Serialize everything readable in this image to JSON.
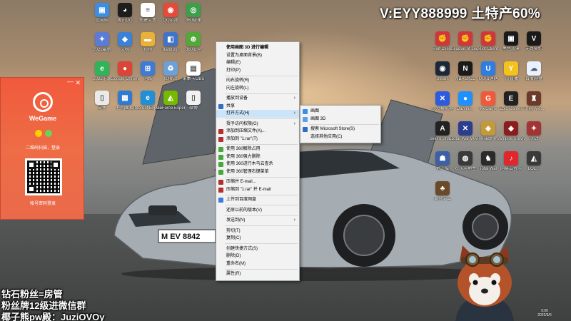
{
  "overlay": {
    "watermark": "V:EYY888999 土特产60%",
    "line1": "钻石粉丝=房管",
    "line2": "粉丝牌12级进微信群",
    "line3": "椰子熊pw殿：JuziOVOy"
  },
  "desktop_icons_left": [
    {
      "name": "this-pc",
      "label": "此电脑",
      "color": "#3a8ee6",
      "glyph": "▣"
    },
    {
      "name": "qq",
      "label": "腾讯QQ",
      "color": "#1d1d1d",
      "glyph": "◕"
    },
    {
      "name": "new-text",
      "label": "新建文本",
      "color": "#ffffff",
      "glyph": "≡"
    },
    {
      "name": "qq-game",
      "label": "QQ游戏",
      "color": "#e84a3a",
      "glyph": "◉"
    },
    {
      "name": "360-speed",
      "label": "360极速",
      "color": "#3ca04b",
      "glyph": "◎"
    },
    {
      "name": "2022-lol",
      "label": "2022最新",
      "color": "#5a7bd6",
      "glyph": "✦"
    },
    {
      "name": "doc",
      "label": "文档",
      "color": "#3b82d6",
      "glyph": "◆"
    },
    {
      "name": "folder1",
      "label": "视频",
      "color": "#e8b23a",
      "glyph": "▬"
    },
    {
      "name": "bandizip",
      "label": "Bandizip",
      "color": "#4074c9",
      "glyph": "◧"
    },
    {
      "name": "360-safe",
      "label": "360安全",
      "color": "#53a83a",
      "glyph": "⊕"
    },
    {
      "name": "iqiyi",
      "label": "2022乐享",
      "color": "#2fb45a",
      "glyph": "e"
    },
    {
      "name": "chrome",
      "label": "Google Chrome",
      "color": "#db4437",
      "glyph": "●"
    },
    {
      "name": "network",
      "label": "网络",
      "color": "#3f7bd4",
      "glyph": "⊞"
    },
    {
      "name": "recycle",
      "label": "回收站",
      "color": "#6da0d8",
      "glyph": "♻"
    },
    {
      "name": "obs",
      "label": "采集卡OBS",
      "color": "#ffffff",
      "glyph": "▤"
    },
    {
      "name": "file2",
      "label": "文件",
      "color": "#eaeaea",
      "glyph": "▯"
    },
    {
      "name": "control",
      "label": "控制面板",
      "color": "#2e7bd1",
      "glyph": "▦"
    },
    {
      "name": "ie",
      "label": "Internet Explorer",
      "color": "#1f8fd8",
      "glyph": "e"
    },
    {
      "name": "geforce",
      "label": "GeForce Experie...",
      "color": "#76b900",
      "glyph": "◭"
    },
    {
      "name": "wps",
      "label": "微博",
      "color": "#f2f2f2",
      "glyph": "▯"
    }
  ],
  "desktop_icons_right": [
    {
      "name": "riot-client",
      "label": "Riot Client",
      "color": "#d13639",
      "glyph": "✊"
    },
    {
      "name": "lol",
      "label": "League of Legend...",
      "color": "#d13639",
      "glyph": "✊"
    },
    {
      "name": "riot2",
      "label": "Riot Client",
      "color": "#d13639",
      "glyph": "✊"
    },
    {
      "name": "black-desert",
      "label": "黑色沙漠",
      "color": "#1a1a1a",
      "glyph": "▣"
    },
    {
      "name": "valorant",
      "label": "无畏契约",
      "color": "#1a1a1a",
      "glyph": "V"
    },
    {
      "name": "steam",
      "label": "Steam",
      "color": "#1b2838",
      "glyph": "◉"
    },
    {
      "name": "nba2k",
      "label": "NBA 2K22",
      "color": "#1a1a1a",
      "glyph": "N"
    },
    {
      "name": "uu",
      "label": "UU加速器",
      "color": "#2f7de1",
      "glyph": "U"
    },
    {
      "name": "yy",
      "label": "YY直播",
      "color": "#f3c21c",
      "glyph": "Y"
    },
    {
      "name": "qq-music",
      "label": "百度网盘",
      "color": "#e8f1ff",
      "glyph": "☁"
    },
    {
      "name": "app-x",
      "label": "小鸡模拟器",
      "color": "#2c5be0",
      "glyph": "✕"
    },
    {
      "name": "danmu",
      "label": "Danmu...",
      "color": "#1e90ff",
      "glyph": "●"
    },
    {
      "name": "wegame-ico",
      "label": "WeGame",
      "color": "#f05a3c",
      "glyph": "G"
    },
    {
      "name": "epic",
      "label": "Epic Games",
      "color": "#222222",
      "glyph": "E"
    },
    {
      "name": "they-are",
      "label": "They Are...",
      "color": "#6b3a2a",
      "glyph": "♜"
    },
    {
      "name": "sekiro",
      "label": "Sekiro Shad...",
      "color": "#222222",
      "glyph": "A"
    },
    {
      "name": "total-war",
      "label": "Total War WARH...",
      "color": "#2a3d8f",
      "glyph": "✕"
    },
    {
      "name": "game-a",
      "label": "英雄联盟",
      "color": "#c29a3a",
      "glyph": "◈"
    },
    {
      "name": "vampire",
      "label": "Vampire Survivors",
      "color": "#8a1e1e",
      "glyph": "◆"
    },
    {
      "name": "game-b",
      "label": "决战",
      "color": "#a23434",
      "glyph": "✦"
    },
    {
      "name": "game-c",
      "label": "地下城",
      "color": "#3c5fa6",
      "glyph": "☗"
    },
    {
      "name": "game-d",
      "label": "欢乐斗地主",
      "color": "#3a3a3a",
      "glyph": "◍"
    },
    {
      "name": "game-e",
      "label": "Total War",
      "color": "#2b2b2b",
      "glyph": "♞"
    },
    {
      "name": "netease-music",
      "label": "网易云音乐",
      "color": "#e0272c",
      "glyph": "♪"
    },
    {
      "name": "game-f",
      "label": "LOL...",
      "color": "#3a3a3a",
      "glyph": "◭"
    },
    {
      "name": "game-g",
      "label": "黄金矿工",
      "color": "#6b4a2a",
      "glyph": "♣"
    }
  ],
  "wegame": {
    "brand": "WeGame",
    "scan_text": "二维码扫描，登录",
    "footer": "帐号密码登录"
  },
  "context_menu": [
    {
      "type": "item",
      "label": "使用画图 3D 进行编辑",
      "bold": true
    },
    {
      "type": "item",
      "label": "设置为桌面背景(B)"
    },
    {
      "type": "item",
      "label": "编辑(E)"
    },
    {
      "type": "item",
      "label": "打印(P)"
    },
    {
      "type": "sep"
    },
    {
      "type": "item",
      "label": "向右旋转(R)"
    },
    {
      "type": "item",
      "label": "向左旋转(L)"
    },
    {
      "type": "sep"
    },
    {
      "type": "item",
      "label": "播放到设备",
      "arrow": true
    },
    {
      "type": "item",
      "label": "共享",
      "icon": "#2a71c7"
    },
    {
      "type": "item",
      "label": "打开方式(H)",
      "arrow": true,
      "highlight": true
    },
    {
      "type": "sep"
    },
    {
      "type": "item",
      "label": "授予访问权限(G)",
      "arrow": true
    },
    {
      "type": "item",
      "label": "添加到压缩文件(A)...",
      "icon": "#b03030"
    },
    {
      "type": "item",
      "label": "添加到 \"1.rar\"(T)",
      "icon": "#b03030"
    },
    {
      "type": "sep"
    },
    {
      "type": "item",
      "label": "使用 360解除占用",
      "icon": "#46a83a"
    },
    {
      "type": "item",
      "label": "使用 360强力删除",
      "icon": "#46a83a"
    },
    {
      "type": "item",
      "label": "使用 360进行木马云查杀",
      "icon": "#46a83a"
    },
    {
      "type": "item",
      "label": "使用 360管理右键菜单",
      "icon": "#46a83a"
    },
    {
      "type": "sep"
    },
    {
      "type": "item",
      "label": "压缩并 E-mail...",
      "icon": "#b03030"
    },
    {
      "type": "item",
      "label": "压缩到 \"1.rar\" 并 E-mail",
      "icon": "#b03030"
    },
    {
      "type": "sep"
    },
    {
      "type": "item",
      "label": "上传到百度网盘",
      "icon": "#3d7be0"
    },
    {
      "type": "sep"
    },
    {
      "type": "item",
      "label": "还原以前的版本(V)"
    },
    {
      "type": "sep"
    },
    {
      "type": "item",
      "label": "发送到(N)",
      "arrow": true
    },
    {
      "type": "sep"
    },
    {
      "type": "item",
      "label": "剪切(T)"
    },
    {
      "type": "item",
      "label": "复制(C)"
    },
    {
      "type": "sep"
    },
    {
      "type": "item",
      "label": "创建快捷方式(S)"
    },
    {
      "type": "item",
      "label": "删除(D)"
    },
    {
      "type": "item",
      "label": "重命名(M)"
    },
    {
      "type": "sep"
    },
    {
      "type": "item",
      "label": "属性(R)"
    }
  ],
  "open_with_menu": [
    {
      "label": "画图",
      "icon": "#3a8ee6"
    },
    {
      "label": "画图 3D",
      "icon": "#5aa0e8"
    },
    {
      "type": "sep"
    },
    {
      "label": "搜索 Microsoft Store(S)",
      "icon": "#2c6fc2"
    },
    {
      "label": "选择其他应用(C)"
    }
  ],
  "clock": {
    "time": "9:00",
    "date": "2022/5/6"
  }
}
